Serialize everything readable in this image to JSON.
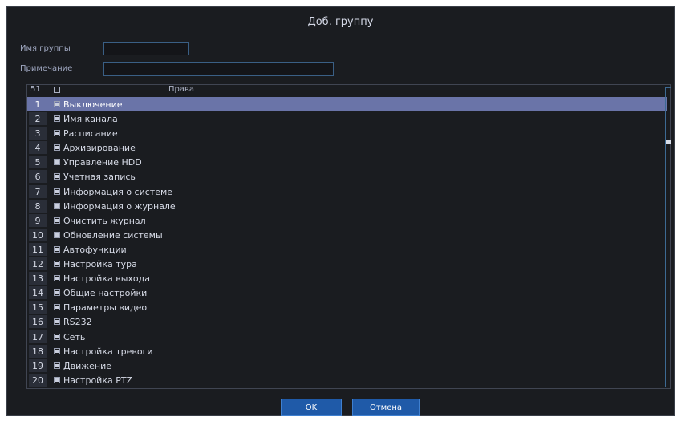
{
  "dialog": {
    "title": "Доб. группу"
  },
  "form": {
    "group_name_label": "Имя группы",
    "group_name_value": "",
    "note_label": "Примечание",
    "note_value": ""
  },
  "table": {
    "count": "51",
    "column_header": "Права",
    "rows": [
      {
        "num": "1",
        "label": "Выключение",
        "checked": true,
        "selected": true
      },
      {
        "num": "2",
        "label": "Имя канала",
        "checked": true,
        "selected": false
      },
      {
        "num": "3",
        "label": "Расписание",
        "checked": true,
        "selected": false
      },
      {
        "num": "4",
        "label": "Архивирование",
        "checked": true,
        "selected": false
      },
      {
        "num": "5",
        "label": "Управление HDD",
        "checked": true,
        "selected": false
      },
      {
        "num": "6",
        "label": "Учетная запись",
        "checked": true,
        "selected": false
      },
      {
        "num": "7",
        "label": "Информация о системе",
        "checked": true,
        "selected": false
      },
      {
        "num": "8",
        "label": "Информация о журнале",
        "checked": true,
        "selected": false
      },
      {
        "num": "9",
        "label": "Очистить журнал",
        "checked": true,
        "selected": false
      },
      {
        "num": "10",
        "label": "Обновление системы",
        "checked": true,
        "selected": false
      },
      {
        "num": "11",
        "label": "Автофункции",
        "checked": true,
        "selected": false
      },
      {
        "num": "12",
        "label": "Настройка тура",
        "checked": true,
        "selected": false
      },
      {
        "num": "13",
        "label": "Настройка выхода",
        "checked": true,
        "selected": false
      },
      {
        "num": "14",
        "label": "Общие настройки",
        "checked": true,
        "selected": false
      },
      {
        "num": "15",
        "label": "Параметры видео",
        "checked": true,
        "selected": false
      },
      {
        "num": "16",
        "label": "RS232",
        "checked": true,
        "selected": false
      },
      {
        "num": "17",
        "label": "Сеть",
        "checked": true,
        "selected": false
      },
      {
        "num": "18",
        "label": "Настройка тревоги",
        "checked": true,
        "selected": false
      },
      {
        "num": "19",
        "label": "Движение",
        "checked": true,
        "selected": false
      },
      {
        "num": "20",
        "label": "Настройка PTZ",
        "checked": true,
        "selected": false
      }
    ]
  },
  "buttons": {
    "ok": "OK",
    "cancel": "Отмена"
  }
}
